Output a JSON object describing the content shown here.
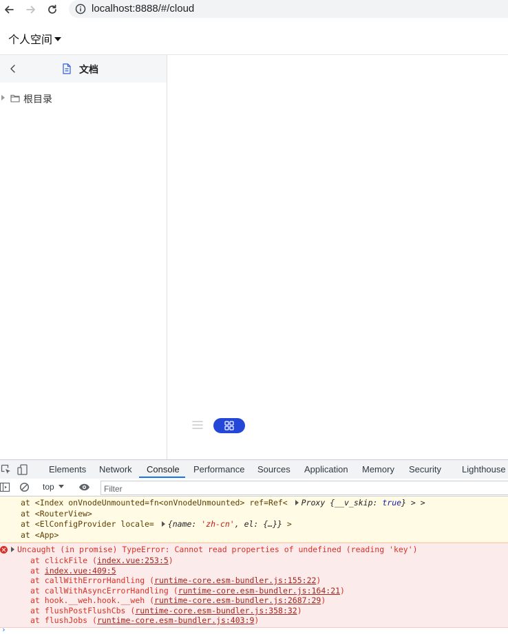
{
  "browser": {
    "url": "localhost:8888/#/cloud"
  },
  "app": {
    "space_title": "个人空间",
    "sidebar": {
      "header_label": "文档",
      "tree": [
        {
          "label": "根目录"
        }
      ]
    }
  },
  "devtools": {
    "tabs": [
      "Elements",
      "Network",
      "Console",
      "Performance",
      "Sources",
      "Application",
      "Memory",
      "Security",
      "Lighthouse"
    ],
    "active_tab": "Console",
    "context": "top",
    "filter_placeholder": "Filter",
    "warning": {
      "line1_prefix": "at <Index onVnodeUnmounted=fn<onVnodeUnmounted> ref=Ref< ",
      "line1_proxy": "Proxy {",
      "line1_key": "__v_skip",
      "line1_colon": ": ",
      "line1_bool": "true",
      "line1_suffix": "} > >",
      "line2": "at <RouterView>",
      "line3_prefix": "at <ElConfigProvider locale= ",
      "line3_obj_a": "{name: ",
      "line3_str": "'zh-cn'",
      "line3_obj_b": ", el: {…}}",
      "line3_suffix": " >",
      "line4": "at <App>"
    },
    "error": {
      "message": "Uncaught (in promise) TypeError: Cannot read properties of undefined (reading 'key')",
      "stack": [
        {
          "fn": "at clickFile (",
          "loc": "index.vue:253:5",
          "end": ")"
        },
        {
          "fn": "at ",
          "loc": "index.vue:409:5",
          "end": ""
        },
        {
          "fn": "at callWithErrorHandling (",
          "loc": "runtime-core.esm-bundler.js:155:22",
          "end": ")"
        },
        {
          "fn": "at callWithAsyncErrorHandling (",
          "loc": "runtime-core.esm-bundler.js:164:21",
          "end": ")"
        },
        {
          "fn": "at hook.__weh.hook.__weh (",
          "loc": "runtime-core.esm-bundler.js:2687:29",
          "end": ")"
        },
        {
          "fn": "at flushPostFlushCbs (",
          "loc": "runtime-core.esm-bundler.js:358:32",
          "end": ")"
        },
        {
          "fn": "at flushJobs (",
          "loc": "runtime-core.esm-bundler.js:403:9",
          "end": ")"
        }
      ]
    },
    "prompt": "›"
  },
  "colors": {
    "accent": "#2447d8",
    "devtools_active": "#1a73e8",
    "error": "#d93025",
    "warning_bg": "#fffbe5",
    "error_bg": "#fcebeb"
  }
}
